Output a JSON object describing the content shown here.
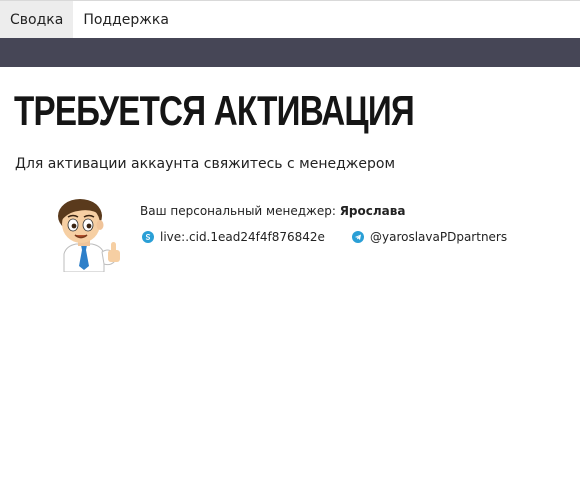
{
  "nav": {
    "tabs": [
      {
        "label": "Сводка",
        "active": true
      },
      {
        "label": "Поддержка",
        "active": false
      }
    ]
  },
  "page": {
    "title": "ТРЕБУЕТСЯ АКТИВАЦИЯ",
    "subtitle": "Для активации аккаунта свяжитесь с менеджером"
  },
  "manager": {
    "label": "Ваш персональный менеджер:",
    "name": "Ярослава",
    "avatar_icon": "cartoon-manager-thumbs-up",
    "skype": {
      "icon": "skype-icon",
      "value": "live:.cid.1ead24f4f876842e"
    },
    "telegram": {
      "icon": "telegram-icon",
      "value": "@yaroslavaPDpartners"
    }
  },
  "colors": {
    "dark_bar": "#464656",
    "active_tab_bg": "#ededed",
    "icon_blue": "#2a9fd6"
  }
}
